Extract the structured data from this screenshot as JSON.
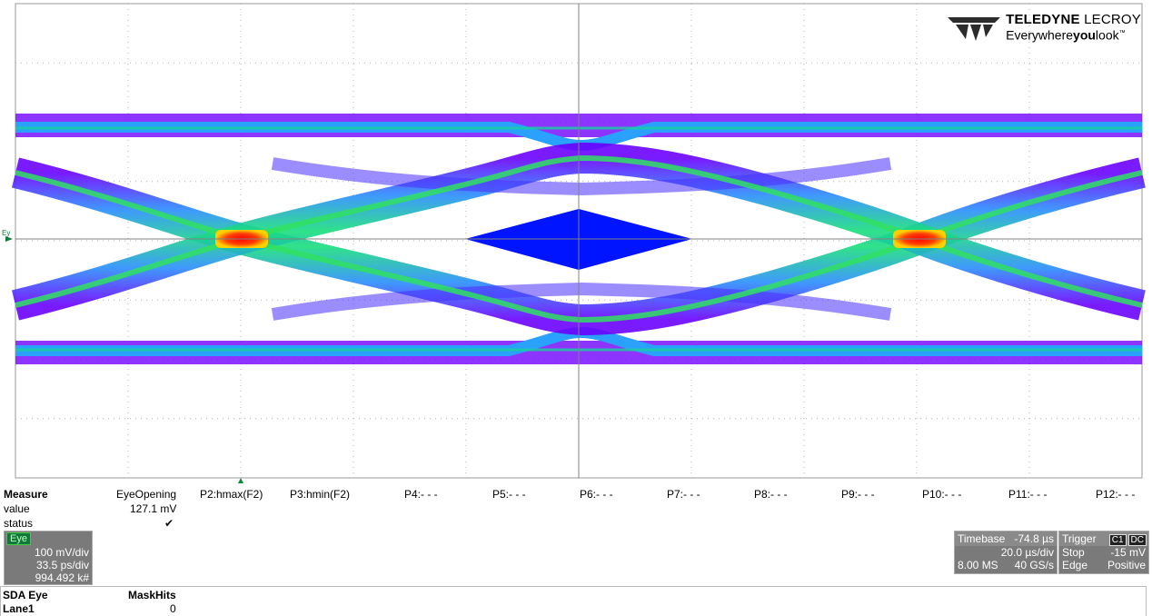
{
  "logo": {
    "brand_bold": "TELEDYNE",
    "brand_rest": " LECROY",
    "tag_pre": "Everywhere",
    "tag_bold": "you",
    "tag_post": "look",
    "tm": "™"
  },
  "trace_label": "Ey",
  "mask_color": "#0014ff",
  "measure": {
    "header": "Measure",
    "rows": [
      "value",
      "status"
    ],
    "params": [
      {
        "name": "EyeOpening",
        "value": "127.1 mV",
        "status": "✔"
      },
      {
        "name": "P2:hmax(F2)",
        "value": "",
        "status": ""
      },
      {
        "name": "P3:hmin(F2)",
        "value": "",
        "status": ""
      },
      {
        "name": "P4:- - -",
        "value": "",
        "status": ""
      },
      {
        "name": "P5:- - -",
        "value": "",
        "status": ""
      },
      {
        "name": "P6:- - -",
        "value": "",
        "status": ""
      },
      {
        "name": "P7:- - -",
        "value": "",
        "status": ""
      },
      {
        "name": "P8:- - -",
        "value": "",
        "status": ""
      },
      {
        "name": "P9:- - -",
        "value": "",
        "status": ""
      },
      {
        "name": "P10:- - -",
        "value": "",
        "status": ""
      },
      {
        "name": "P11:- - -",
        "value": "",
        "status": ""
      },
      {
        "name": "P12:- - -",
        "value": "",
        "status": ""
      }
    ]
  },
  "eye_box": {
    "tag": "Eye",
    "vdiv": "100 mV/div",
    "hdiv": "33.5 ps/div",
    "count": "994.492 k#"
  },
  "timebase": {
    "label": "Timebase",
    "offset": "-74.8 µs",
    "tdiv": "20.0 µs/div",
    "samples": "8.00 MS",
    "rate": "40 GS/s"
  },
  "trigger": {
    "label": "Trigger",
    "ch": "C1",
    "coupling": "DC",
    "mode": "Stop",
    "level": "-15 mV",
    "type": "Edge",
    "slope": "Positive"
  },
  "results": {
    "col1_header": "SDA Eye",
    "col2_header": "MaskHits",
    "row_label": "Lane1",
    "row_value": "0"
  }
}
